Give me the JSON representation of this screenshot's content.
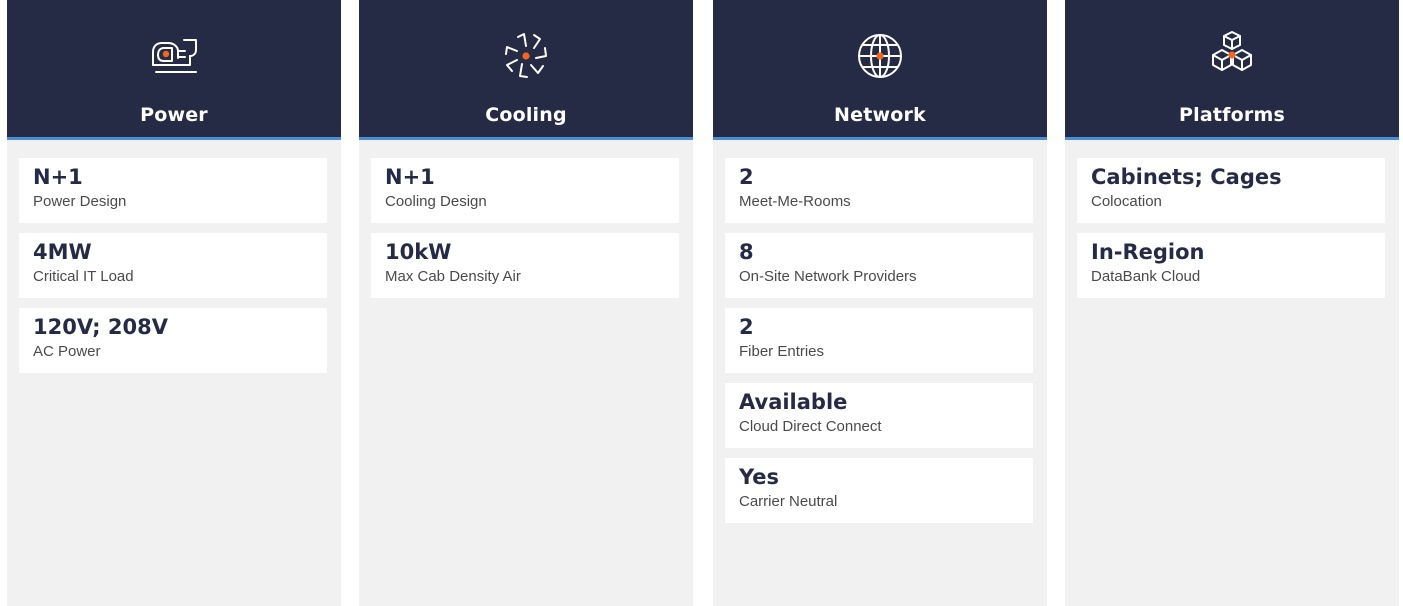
{
  "accent_color": "#f26522",
  "header_color": "#262b45",
  "header_border_color": "#4a8fd4",
  "columns": [
    {
      "title": "Power",
      "icon": "power-plug-icon",
      "cards": [
        {
          "value": "N+1",
          "label": "Power Design"
        },
        {
          "value": "4MW",
          "label": "Critical IT Load"
        },
        {
          "value": "120V; 208V",
          "label": "AC Power"
        }
      ]
    },
    {
      "title": "Cooling",
      "icon": "fan-icon",
      "cards": [
        {
          "value": "N+1",
          "label": "Cooling Design"
        },
        {
          "value": "10kW",
          "label": "Max Cab Density Air"
        }
      ]
    },
    {
      "title": "Network",
      "icon": "globe-icon",
      "cards": [
        {
          "value": "2",
          "label": "Meet-Me-Rooms"
        },
        {
          "value": "8",
          "label": "On-Site Network Providers"
        },
        {
          "value": "2",
          "label": "Fiber Entries"
        },
        {
          "value": "Available",
          "label": "Cloud Direct Connect"
        },
        {
          "value": "Yes",
          "label": "Carrier Neutral"
        }
      ]
    },
    {
      "title": "Platforms",
      "icon": "cubes-icon",
      "cards": [
        {
          "value": "Cabinets; Cages",
          "label": "Colocation"
        },
        {
          "value": "In-Region",
          "label": "DataBank Cloud"
        }
      ]
    }
  ]
}
